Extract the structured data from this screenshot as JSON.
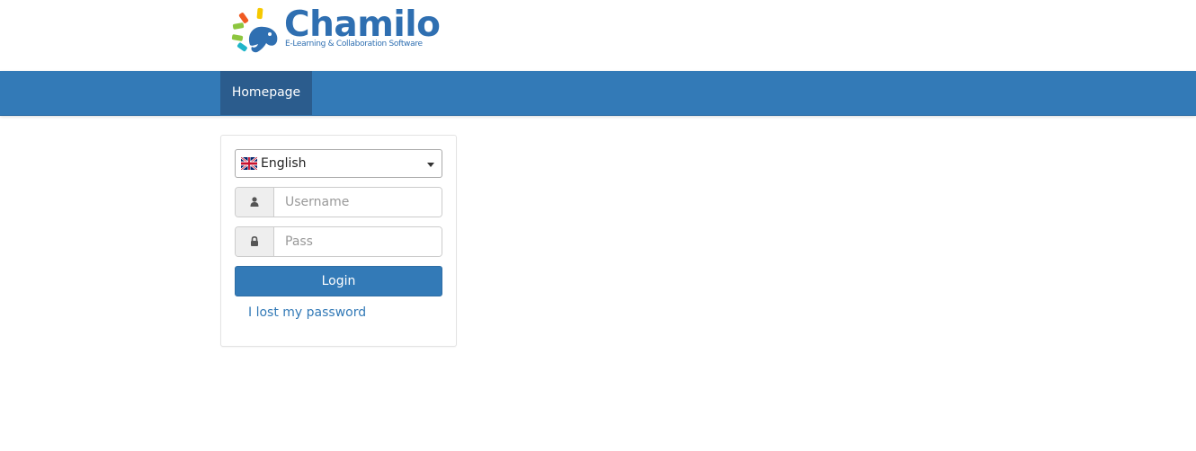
{
  "header": {
    "logo_title": "Chamilo",
    "logo_subtitle": "E-Learning & Collaboration Software"
  },
  "navbar": {
    "items": [
      {
        "label": "Homepage",
        "active": true
      }
    ]
  },
  "login_form": {
    "language": {
      "selected": "English",
      "flag_icon": "uk-flag-icon"
    },
    "username": {
      "placeholder": "Username",
      "value": "",
      "icon": "user-icon"
    },
    "password": {
      "placeholder": "Pass",
      "value": "",
      "icon": "lock-icon"
    },
    "login_label": "Login",
    "lost_password_label": "I lost my password"
  },
  "colors": {
    "brand": "#337ab7",
    "nav_active": "#2b5c8d",
    "logo_text": "#2f6fb1"
  }
}
